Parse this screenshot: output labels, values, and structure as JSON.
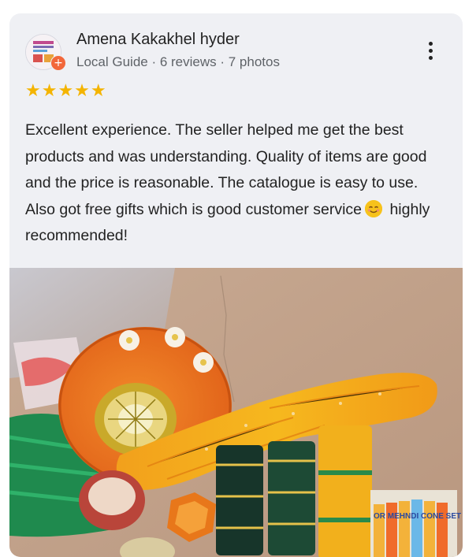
{
  "review": {
    "author": "Amena Kakakhel hyder",
    "meta": "Local Guide · 6 reviews · 7 photos",
    "rating": 5,
    "stars": "★★★★★",
    "text_before_emoji": "Excellent experience. The seller helped me get the best products and was understanding. Quality of items are good and the price is reasonable. The catalogue is easy to use. Also got free gifts which is good customer service",
    "text_after_emoji": " highly recommended!"
  },
  "photo": {
    "mehndi_box_text": "OR MEHNDI CONE SET"
  },
  "colors": {
    "card_bg": "#eff0f4",
    "star": "#f4b400",
    "guide_badge": "#f2673a"
  }
}
